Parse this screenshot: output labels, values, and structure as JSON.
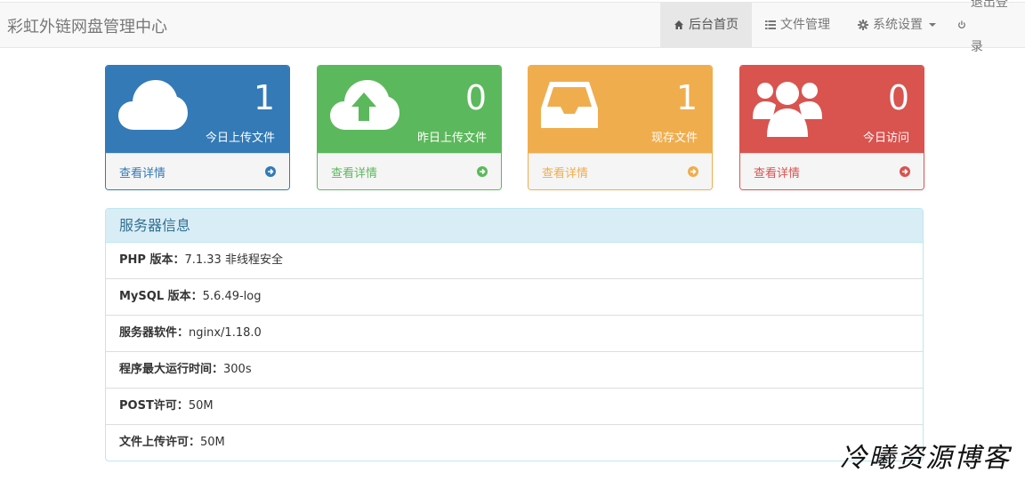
{
  "navbar": {
    "brand": "彩虹外链网盘管理中心",
    "items": [
      {
        "label": "后台首页",
        "icon": "home-icon",
        "active": true
      },
      {
        "label": "文件管理",
        "icon": "list-icon",
        "active": false
      },
      {
        "label": "系统设置",
        "icon": "gear-icon",
        "active": false,
        "dropdown": true
      },
      {
        "label": "退出登录",
        "icon": "power-icon",
        "active": false
      }
    ]
  },
  "stats": [
    {
      "value": "1",
      "label": "今日上传文件",
      "link": "查看详情",
      "icon": "cloud-icon",
      "color": "#337ab7"
    },
    {
      "value": "0",
      "label": "昨日上传文件",
      "link": "查看详情",
      "icon": "cloud-upload-icon",
      "color": "#5cb85c"
    },
    {
      "value": "1",
      "label": "现存文件",
      "link": "查看详情",
      "icon": "inbox-icon",
      "color": "#f0ad4e"
    },
    {
      "value": "0",
      "label": "今日访问",
      "link": "查看详情",
      "icon": "users-icon",
      "color": "#d9534f"
    }
  ],
  "server_info": {
    "title": "服务器信息",
    "rows": [
      {
        "key": "PHP 版本：",
        "value": "7.1.33 非线程安全"
      },
      {
        "key": "MySQL 版本：",
        "value": "5.6.49-log"
      },
      {
        "key": "服务器软件：",
        "value": "nginx/1.18.0"
      },
      {
        "key": "程序最大运行时间：",
        "value": "300s"
      },
      {
        "key": "POST许可：",
        "value": "50M"
      },
      {
        "key": "文件上传许可：",
        "value": "50M"
      }
    ]
  },
  "watermark": "冷曦资源博客"
}
